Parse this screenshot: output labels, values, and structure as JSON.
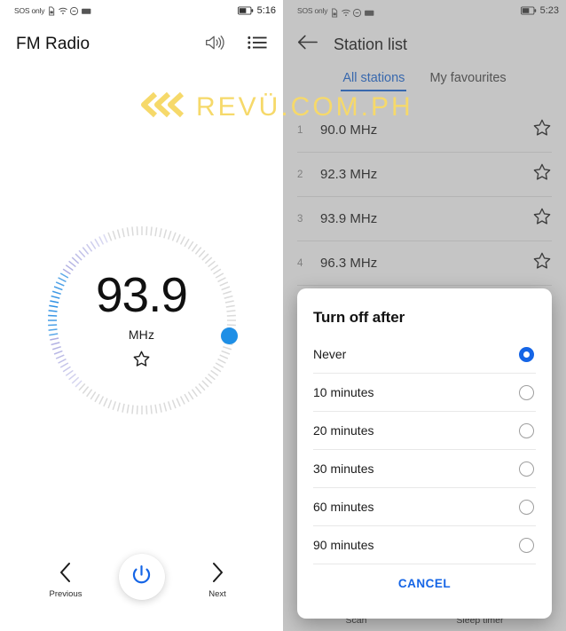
{
  "watermark": {
    "text": "REVÜ.COM.PH",
    "logo": "triple-chevron-left",
    "color": "#f6d96a"
  },
  "left_phone": {
    "statusbar": {
      "carrier": "SOS only",
      "time": "5:16",
      "icons": [
        "sim-card-icon",
        "wifi-icon",
        "no-sound-icon",
        "battery-saver-icon",
        "battery-icon"
      ]
    },
    "appbar": {
      "title": "FM Radio",
      "speaker_icon": "speaker-icon",
      "list_icon": "station-list-icon"
    },
    "dial": {
      "frequency": "93.9",
      "unit": "MHz",
      "favourite_icon": "star-outline-icon",
      "knob_color": "#1e8fe6",
      "tick_count": 120,
      "knob_angle_deg": 100
    },
    "controls": {
      "previous": {
        "label": "Previous",
        "icon": "chevron-left-icon"
      },
      "power": {
        "icon": "power-icon",
        "color": "#1565e6"
      },
      "next": {
        "label": "Next",
        "icon": "chevron-right-icon"
      }
    }
  },
  "right_phone": {
    "statusbar": {
      "carrier": "SOS only",
      "time": "5:23",
      "icons": [
        "sim-card-icon",
        "wifi-icon",
        "no-sound-icon",
        "battery-saver-icon",
        "battery-icon"
      ]
    },
    "appbar": {
      "back_icon": "arrow-left-icon",
      "title": "Station list"
    },
    "tabs": [
      {
        "label": "All stations",
        "active": true
      },
      {
        "label": "My favourites",
        "active": false
      }
    ],
    "stations": [
      {
        "num": "1",
        "name": "90.0 MHz",
        "fav_icon": "star-outline-icon"
      },
      {
        "num": "2",
        "name": "92.3 MHz",
        "fav_icon": "star-outline-icon"
      },
      {
        "num": "3",
        "name": "93.9 MHz",
        "fav_icon": "star-outline-icon"
      },
      {
        "num": "4",
        "name": "96.3 MHz",
        "fav_icon": "star-outline-icon"
      }
    ],
    "bottom_bar": [
      {
        "label": "Scan"
      },
      {
        "label": "Sleep timer"
      }
    ],
    "dialog": {
      "title": "Turn off after",
      "options": [
        {
          "label": "Never",
          "selected": true
        },
        {
          "label": "10 minutes",
          "selected": false
        },
        {
          "label": "20 minutes",
          "selected": false
        },
        {
          "label": "30 minutes",
          "selected": false
        },
        {
          "label": "60 minutes",
          "selected": false
        },
        {
          "label": "90 minutes",
          "selected": false
        }
      ],
      "cancel_label": "CANCEL",
      "accent_color": "#1565e6"
    }
  }
}
